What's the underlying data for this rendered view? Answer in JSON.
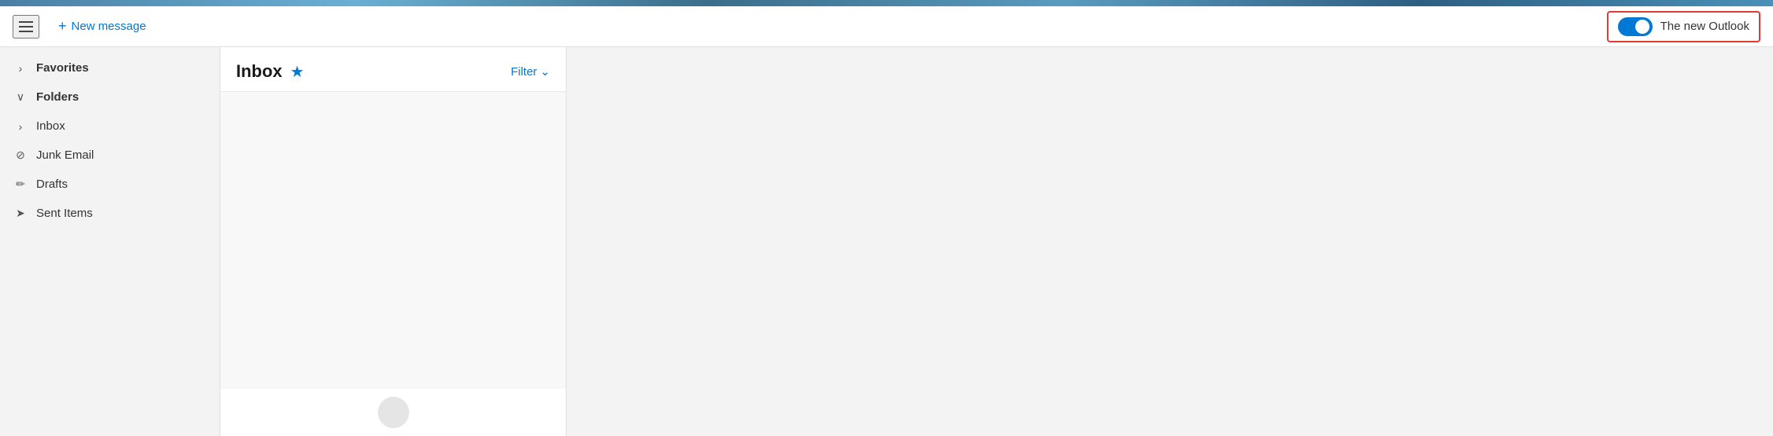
{
  "topStrip": {
    "visible": true
  },
  "toolbar": {
    "hamburger_label": "Menu",
    "new_message_label": "New message",
    "new_outlook_label": "The new Outlook",
    "new_outlook_toggle_state": "on"
  },
  "sidebar": {
    "items": [
      {
        "id": "favorites",
        "label": "Favorites",
        "icon": "chevron-right",
        "type": "section-header"
      },
      {
        "id": "folders",
        "label": "Folders",
        "icon": "chevron-down",
        "type": "section-header"
      },
      {
        "id": "inbox",
        "label": "Inbox",
        "icon": "chevron-right",
        "type": "folder"
      },
      {
        "id": "junk-email",
        "label": "Junk Email",
        "icon": "junk",
        "type": "folder"
      },
      {
        "id": "drafts",
        "label": "Drafts",
        "icon": "pencil",
        "type": "folder"
      },
      {
        "id": "sent-items",
        "label": "Sent Items",
        "icon": "sent",
        "type": "folder"
      }
    ]
  },
  "emailListPanel": {
    "title": "Inbox",
    "filter_label": "Filter",
    "chevron_icon": "chevron-down"
  },
  "icons": {
    "hamburger": "☰",
    "plus": "+",
    "chevron_right": "›",
    "chevron_down": "∨",
    "star": "★",
    "filter_chevron": "⌄",
    "junk": "⊘",
    "pencil": "✏",
    "sent": "➤"
  }
}
